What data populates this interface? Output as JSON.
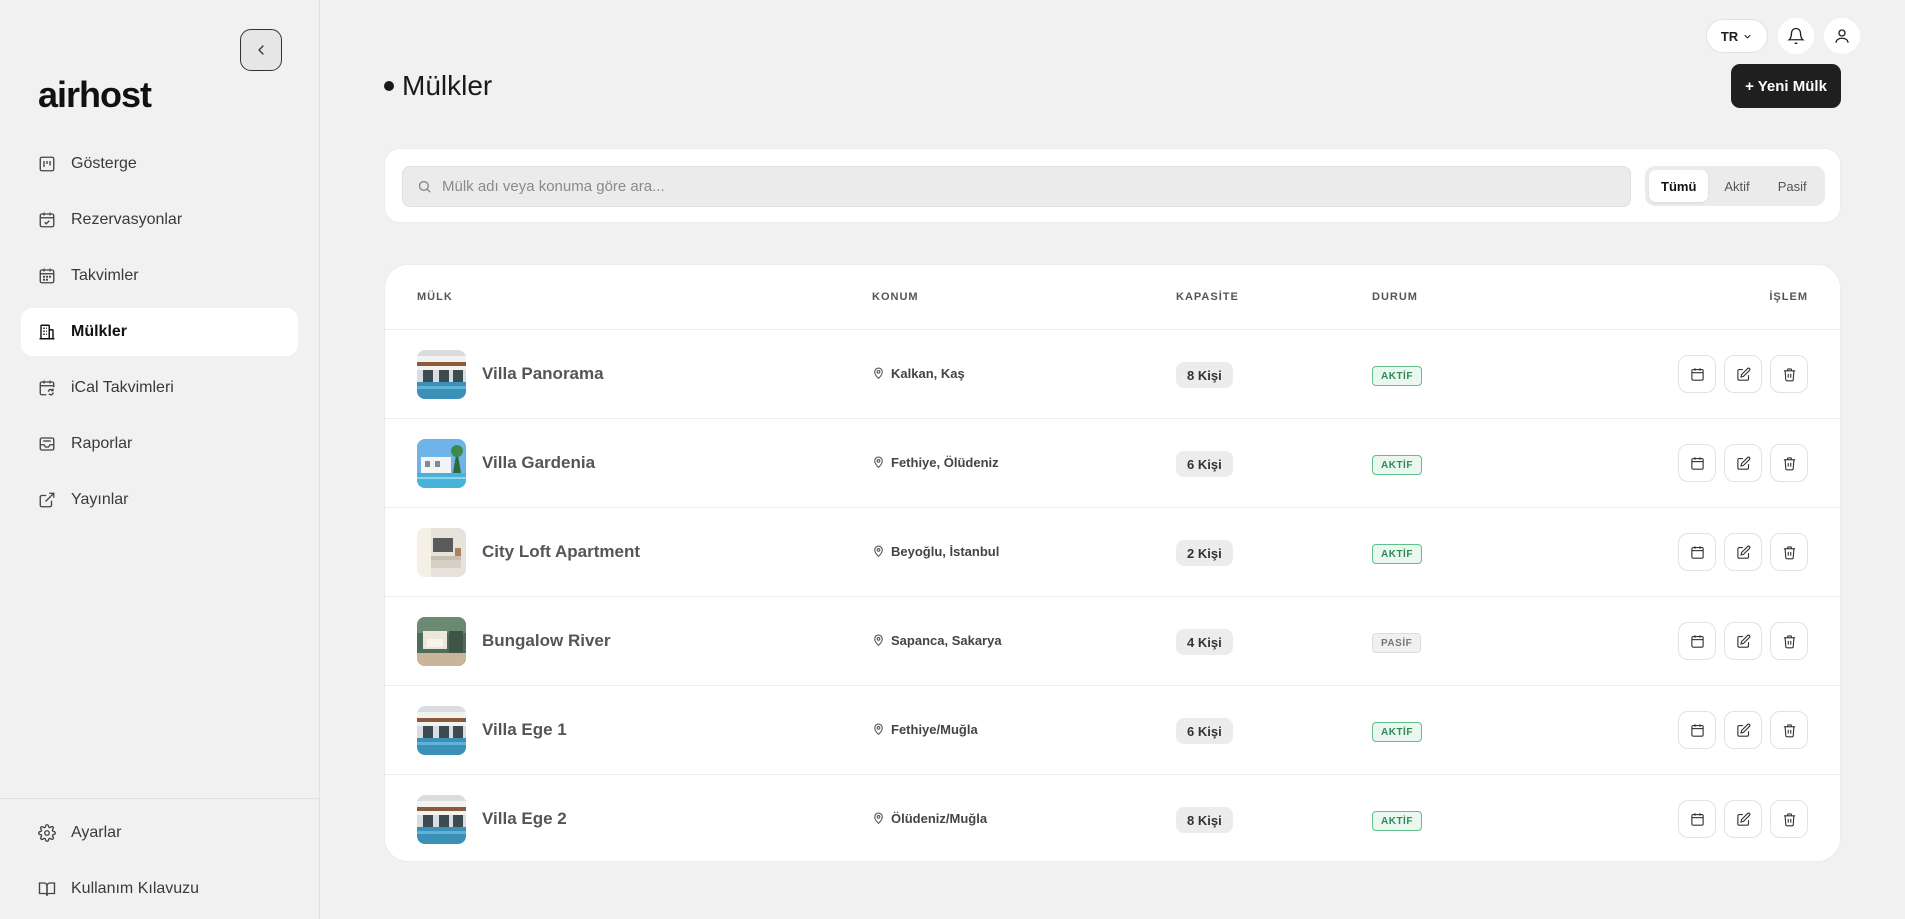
{
  "brand": {
    "logo": "airhost"
  },
  "sidebar": {
    "items": [
      {
        "label": "Gösterge",
        "icon": "dashboard-icon",
        "active": false
      },
      {
        "label": "Rezervasyonlar",
        "icon": "calendar-check-icon",
        "active": false
      },
      {
        "label": "Takvimler",
        "icon": "calendar-icon",
        "active": false
      },
      {
        "label": "Mülkler",
        "icon": "building-icon",
        "active": true
      },
      {
        "label": "iCal Takvimleri",
        "icon": "calendar-sync-icon",
        "active": false
      },
      {
        "label": "Raporlar",
        "icon": "inbox-icon",
        "active": false
      },
      {
        "label": "Yayınlar",
        "icon": "external-link-icon",
        "active": false
      }
    ],
    "bottom": [
      {
        "label": "Ayarlar",
        "icon": "gear-icon"
      },
      {
        "label": "Kullanım Kılavuzu",
        "icon": "book-icon"
      }
    ]
  },
  "topbar": {
    "language": "TR"
  },
  "header": {
    "title": "Mülkler",
    "new_button": "+ Yeni Mülk"
  },
  "search": {
    "placeholder": "Mülk adı veya konuma göre ara...",
    "filters": [
      {
        "label": "Tümü",
        "active": true
      },
      {
        "label": "Aktif",
        "active": false
      },
      {
        "label": "Pasif",
        "active": false
      }
    ]
  },
  "table": {
    "columns": {
      "property": "MÜLK",
      "location": "KONUM",
      "capacity": "KAPASİTE",
      "status": "DURUM",
      "action": "İŞLEM"
    },
    "rows": [
      {
        "name": "Villa Panorama",
        "location": "Kalkan, Kaş",
        "capacity": "8 Kişi",
        "status": "AKTİF",
        "active": true,
        "thumb": "pool"
      },
      {
        "name": "Villa Gardenia",
        "location": "Fethiye, Ölüdeniz",
        "capacity": "6 Kişi",
        "status": "AKTİF",
        "active": true,
        "thumb": "garden"
      },
      {
        "name": "City Loft Apartment",
        "location": "Beyoğlu, İstanbul",
        "capacity": "2 Kişi",
        "status": "AKTİF",
        "active": true,
        "thumb": "loft"
      },
      {
        "name": "Bungalow River",
        "location": "Sapanca, Sakarya",
        "capacity": "4 Kişi",
        "status": "PASİF",
        "active": false,
        "thumb": "bungalow"
      },
      {
        "name": "Villa Ege 1",
        "location": "Fethiye/Muğla",
        "capacity": "6 Kişi",
        "status": "AKTİF",
        "active": true,
        "thumb": "pool"
      },
      {
        "name": "Villa Ege 2",
        "location": "Ölüdeniz/Muğla",
        "capacity": "8 Kişi",
        "status": "AKTİF",
        "active": true,
        "thumb": "pool"
      }
    ]
  },
  "colors": {
    "accent": "#1f1f1f",
    "active_status": "#2e8b57",
    "passive_status": "#777777",
    "background": "#f1f1f1"
  }
}
